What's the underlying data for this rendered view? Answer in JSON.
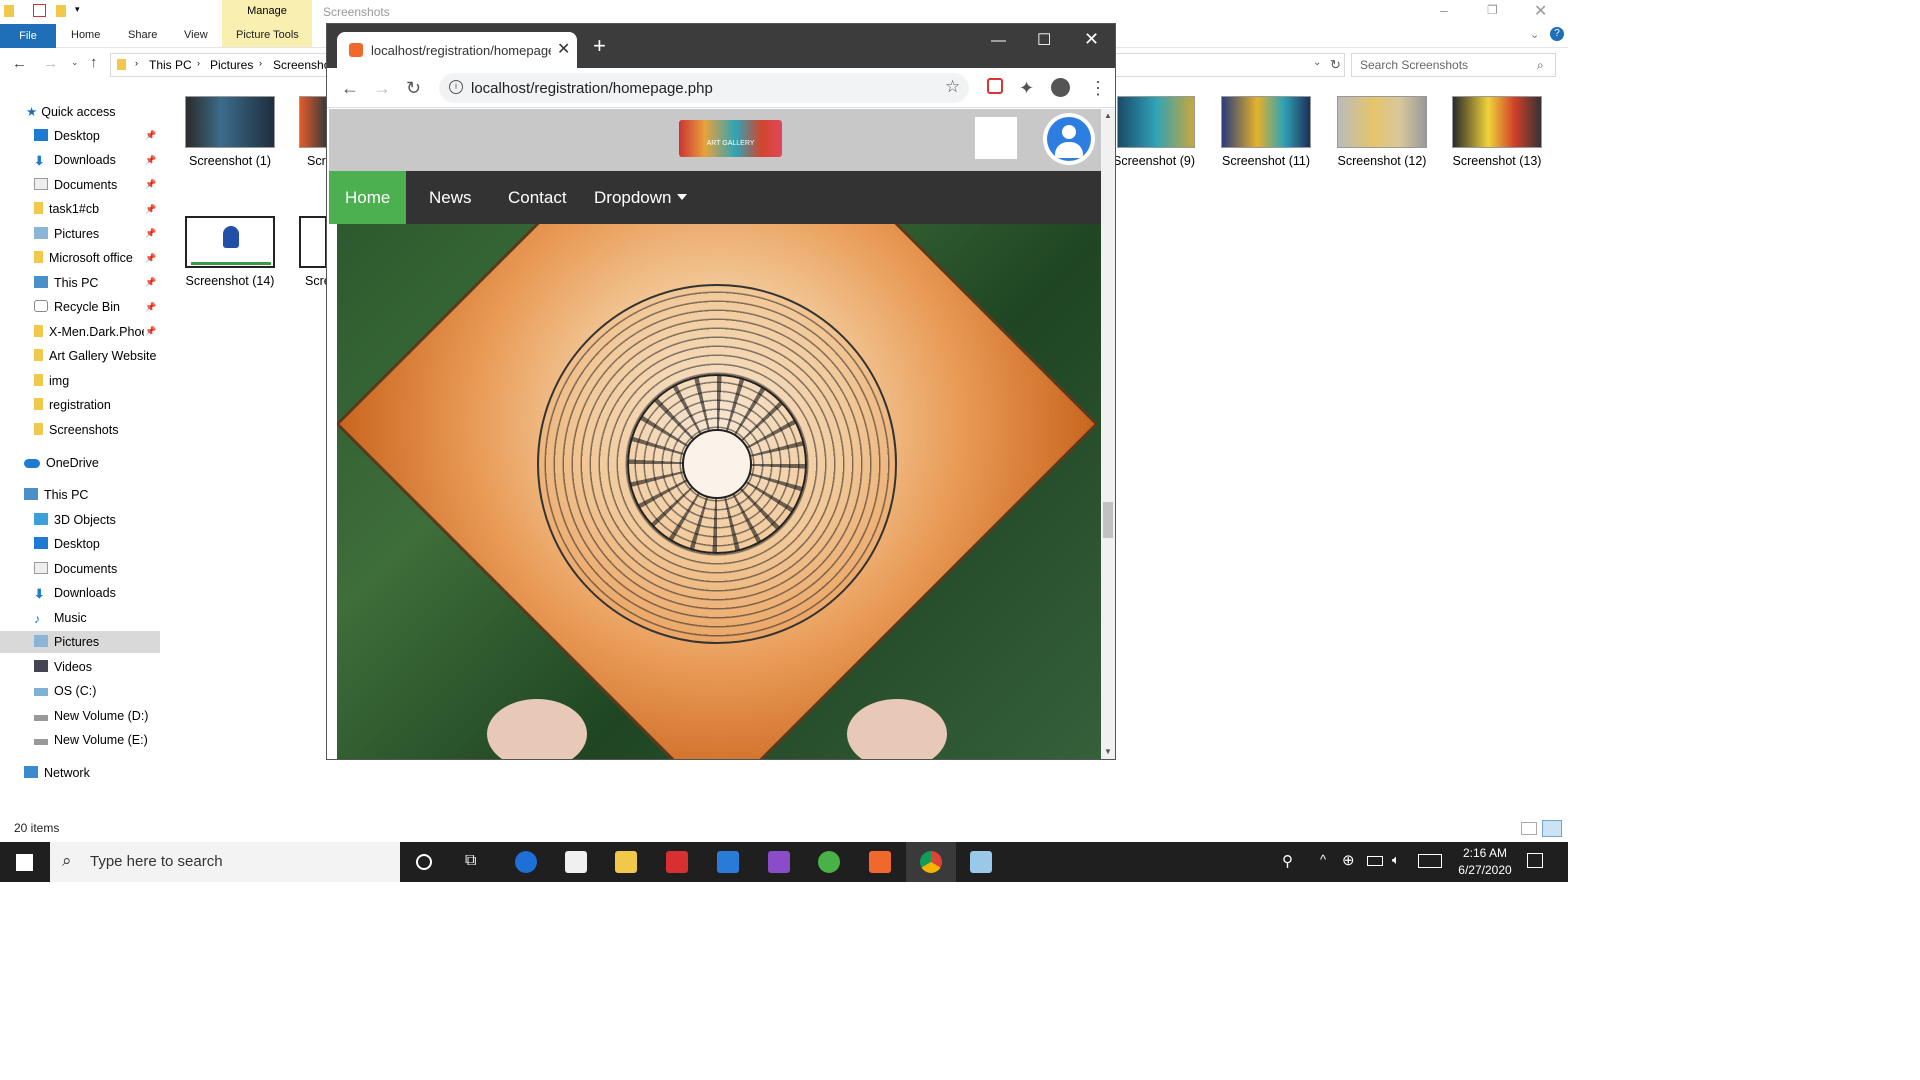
{
  "explorer": {
    "window_title": "Screenshots",
    "manage_label": "Manage",
    "ribbon_tabs": [
      "File",
      "Home",
      "Share",
      "View",
      "Picture Tools"
    ],
    "breadcrumb": [
      "This PC",
      "Pictures",
      "Screensho"
    ],
    "search_placeholder": "Search Screenshots",
    "nav": {
      "quick_access": "Quick access",
      "quick_items": [
        "Desktop",
        "Downloads",
        "Documents",
        "task1#cb",
        "Pictures",
        "Microsoft office",
        "This PC",
        "Recycle Bin",
        "X-Men.Dark.Phoe",
        "Art Gallery Website",
        "img",
        "registration",
        "Screenshots"
      ],
      "onedrive": "OneDrive",
      "this_pc": "This PC",
      "pc_items": [
        "3D Objects",
        "Desktop",
        "Documents",
        "Downloads",
        "Music",
        "Pictures",
        "Videos",
        "OS (C:)",
        "New Volume (D:)",
        "New Volume (E:)"
      ],
      "network": "Network"
    },
    "files": [
      "Screenshot (1)",
      "Scr",
      "Screenshot (14)",
      "Scre",
      "Screenshot (9)",
      "Screenshot (11)",
      "Screenshot (12)",
      "Screenshot (13)"
    ],
    "status": "20 items"
  },
  "chrome": {
    "tab_title": "localhost/registration/homepage",
    "url": "localhost/registration/homepage.php"
  },
  "site": {
    "logo_text": "ART GALLERY",
    "nav": [
      "Home",
      "News",
      "Contact",
      "Dropdown"
    ]
  },
  "taskbar": {
    "search_placeholder": "Type here to search",
    "time": "2:16 AM",
    "date": "6/27/2020"
  }
}
